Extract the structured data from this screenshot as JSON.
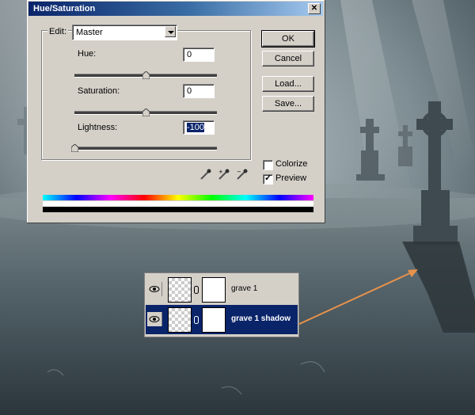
{
  "dialog": {
    "title": "Hue/Saturation",
    "close_glyph": "✕",
    "edit_label": "Edit:",
    "edit_value": "Master",
    "hue_label": "Hue:",
    "hue_value": "0",
    "hue_level": 0.5,
    "saturation_label": "Saturation:",
    "saturation_value": "0",
    "saturation_level": 0.5,
    "lightness_label": "Lightness:",
    "lightness_value": "-100",
    "lightness_level": 0.0,
    "buttons": {
      "ok": "OK",
      "cancel": "Cancel",
      "load": "Load...",
      "save": "Save..."
    },
    "colorize_label": "Colorize",
    "colorize_checked": false,
    "preview_label": "Preview",
    "preview_checked": true,
    "icons": [
      "eyedropper-icon",
      "eyedropper-plus-icon",
      "eyedropper-minus-icon"
    ]
  },
  "layers": [
    {
      "name": "grave 1",
      "active": false
    },
    {
      "name": "grave 1 shadow",
      "active": true
    }
  ],
  "colors": {
    "dialog_bg": "#d4d0c8",
    "title_start": "#0a246a",
    "title_end": "#a6caf0",
    "selection": "#0a246a",
    "arrow": "#e8924a"
  }
}
